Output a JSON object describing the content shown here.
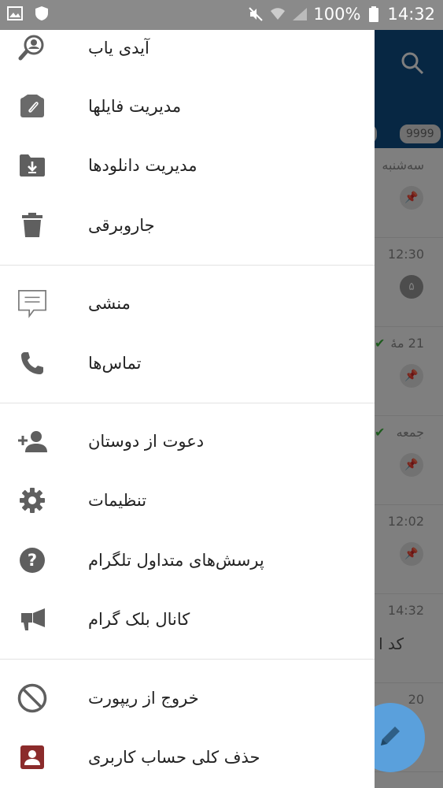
{
  "status_bar": {
    "battery_percent": "100%",
    "time": "14:32"
  },
  "background": {
    "badges": [
      "9",
      "9999"
    ],
    "rows": [
      {
        "time": "سه‌شنبه",
        "badge": ""
      },
      {
        "time": "12:30",
        "badge": "۵"
      },
      {
        "time": "21 مهٔ",
        "badge": ""
      },
      {
        "time": "جمعه",
        "badge": ""
      },
      {
        "time": "12:02",
        "badge": ""
      },
      {
        "time": "14:32",
        "preview": "کد ا"
      },
      {
        "time": "20",
        "badge": ""
      }
    ]
  },
  "drawer": {
    "items": [
      {
        "label": "آیدی یاب",
        "icon": "search-person-icon"
      },
      {
        "label": "مدیریت فایلها",
        "icon": "paperclip-box-icon"
      },
      {
        "label": "مدیریت دانلودها",
        "icon": "folder-download-icon"
      },
      {
        "label": "جاروبرقی",
        "icon": "trash-icon"
      },
      {
        "label": "منشی",
        "icon": "message-bubble-icon"
      },
      {
        "label": "تماس‌ها",
        "icon": "phone-icon"
      },
      {
        "label": "دعوت از دوستان",
        "icon": "add-person-icon"
      },
      {
        "label": "تنظیمات",
        "icon": "gear-icon"
      },
      {
        "label": "پرسش‌های متداول تلگرام",
        "icon": "help-icon"
      },
      {
        "label": "کانال بلک گرام",
        "icon": "megaphone-icon"
      },
      {
        "label": "خروج از ریپورت",
        "icon": "block-icon"
      },
      {
        "label": "حذف کلی حساب کاربری",
        "icon": "account-box-icon"
      }
    ]
  },
  "colors": {
    "header_blue": "#0f4f86",
    "fab_blue": "#5aa0dc",
    "icon_gray": "#5f5f5f",
    "account_icon_red": "#8b2b2b",
    "check_green": "#3bb53b"
  }
}
